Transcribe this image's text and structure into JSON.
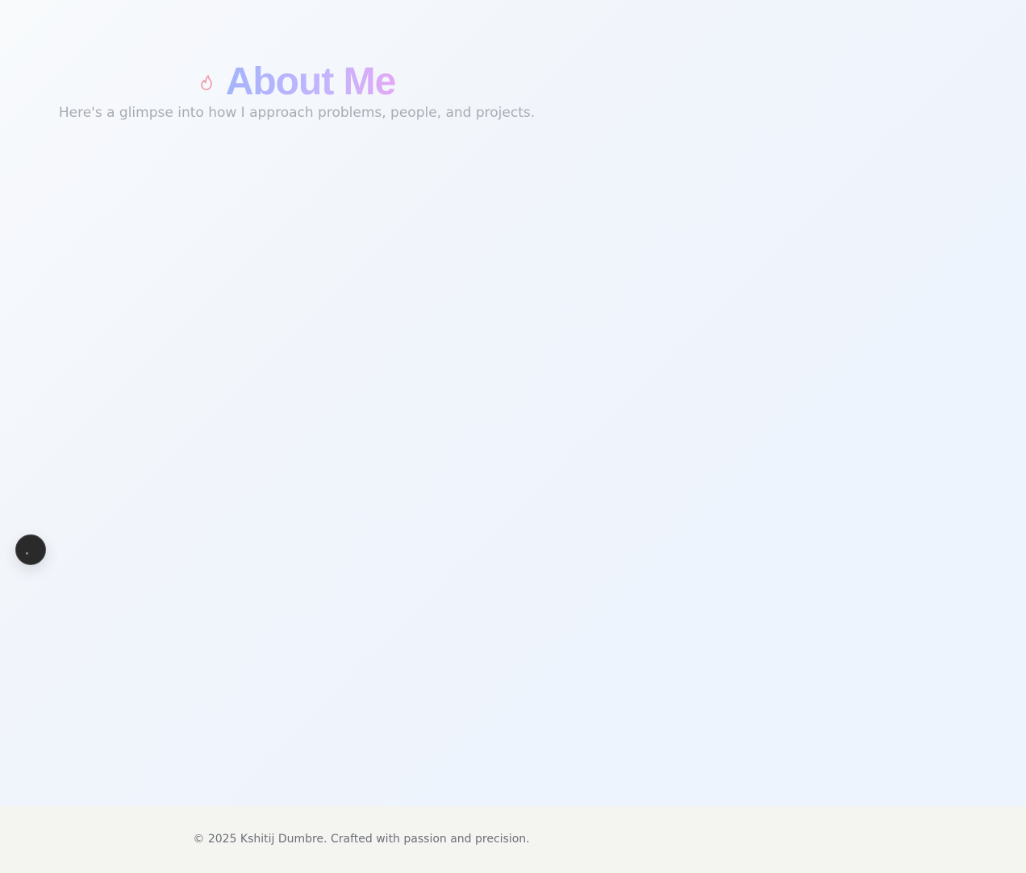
{
  "hero": {
    "icon": "flame-icon",
    "title": "About Me",
    "subtitle": "Here's a glimpse into how I approach problems, people, and projects."
  },
  "floating_button": {
    "icon": "dot-icon"
  },
  "footer": {
    "copyright": "© 2025 Kshitij Dumbre. Crafted with passion and precision."
  },
  "colors": {
    "title_gradient_start": "#a5b4fc",
    "title_gradient_end": "#e3a8f5",
    "flame": "#f0a3b0",
    "subtitle": "#a8acb4",
    "footer_background": "#f4f4f0",
    "footer_text": "#6b6f78",
    "floating_button": "#2a2a2a"
  }
}
